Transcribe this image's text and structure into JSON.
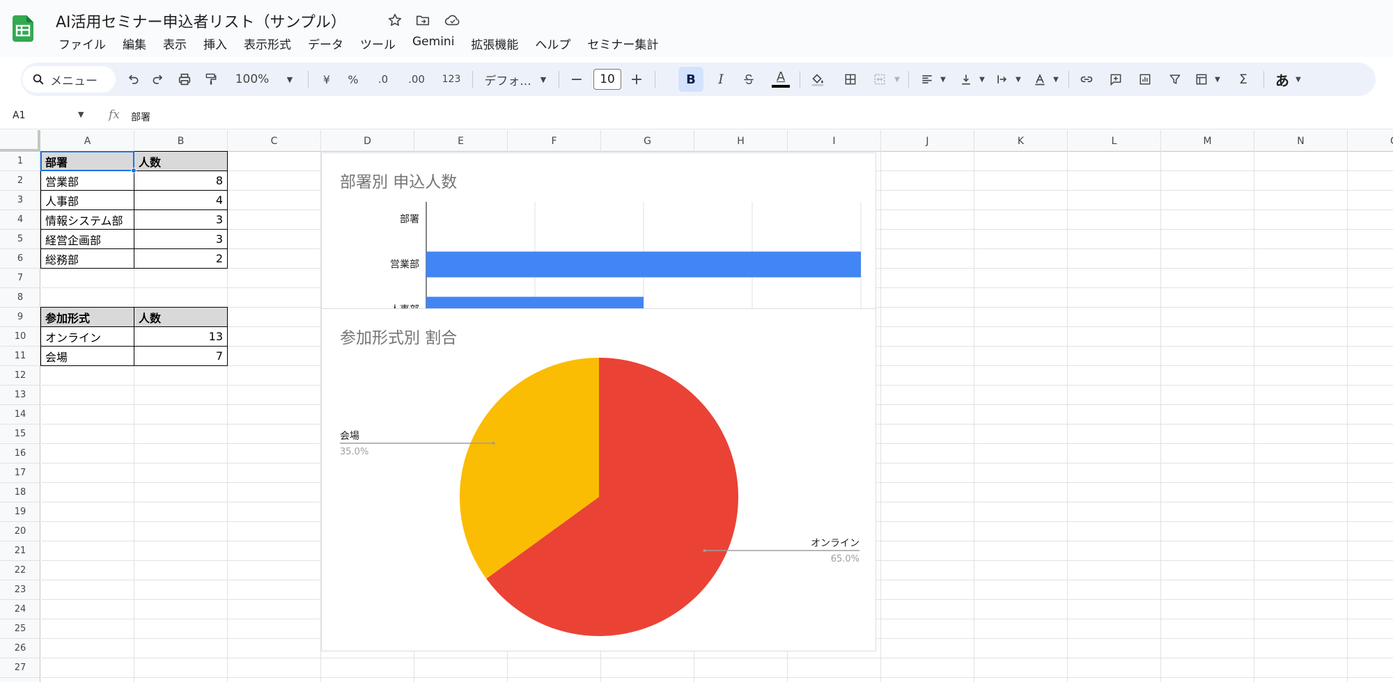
{
  "app": {
    "doc_title": "AI活用セミナー申込者リスト（サンプル）",
    "menu": [
      "ファイル",
      "編集",
      "表示",
      "挿入",
      "表示形式",
      "データ",
      "ツール",
      "Gemini",
      "拡張機能",
      "ヘルプ",
      "セミナー集計"
    ]
  },
  "toolbar": {
    "search_label": "メニュー",
    "zoom": "100%",
    "currency": "¥",
    "percent": "%",
    "decrease_decimal": ".0",
    "increase_decimal": ".00",
    "number_format": "123",
    "font_name": "デフォ...",
    "minus": "−",
    "font_size": "10",
    "plus": "+",
    "bold": "B",
    "italic": "I",
    "text_color": "A",
    "function": "Σ",
    "input_mode": "あ"
  },
  "formula_bar": {
    "cell_ref": "A1",
    "fx": "fx",
    "value": "部署"
  },
  "sheet": {
    "columns": [
      "A",
      "B",
      "C",
      "D",
      "E",
      "F",
      "G",
      "H",
      "I",
      "J",
      "K",
      "L",
      "M",
      "N",
      "O"
    ],
    "rows": [
      "1",
      "2",
      "3",
      "4",
      "5",
      "6",
      "7",
      "8",
      "9",
      "10",
      "11",
      "12",
      "13",
      "14",
      "15",
      "16",
      "17",
      "18",
      "19",
      "20",
      "21",
      "22",
      "23",
      "24",
      "25",
      "26",
      "27"
    ],
    "table1": {
      "header": [
        "部署",
        "人数"
      ],
      "rows": [
        {
          "label": "営業部",
          "value": "8"
        },
        {
          "label": "人事部",
          "value": "4"
        },
        {
          "label": "情報システム部",
          "value": "3"
        },
        {
          "label": "経営企画部",
          "value": "3"
        },
        {
          "label": "総務部",
          "value": "2"
        }
      ]
    },
    "table2": {
      "header": [
        "参加形式",
        "人数"
      ],
      "rows": [
        {
          "label": "オンライン",
          "value": "13"
        },
        {
          "label": "会場",
          "value": "7"
        }
      ]
    }
  },
  "colors": {
    "bar": "#4285f4",
    "online": "#ea4335",
    "venue": "#fbbc04",
    "selection": "#1a73e8"
  },
  "chart_data": [
    {
      "type": "bar",
      "orientation": "horizontal",
      "title": "部署別 申込人数",
      "categories": [
        "部署",
        "営業部",
        "人事部"
      ],
      "values": [
        0,
        8,
        4
      ],
      "xlim": [
        0,
        8
      ],
      "grid": true,
      "note": "chart partially covered by pie chart; only first categories visible"
    },
    {
      "type": "pie",
      "title": "参加形式別 割合",
      "slices": [
        {
          "label": "オンライン",
          "value": 13,
          "percent_label": "65.0%",
          "color": "#ea4335"
        },
        {
          "label": "会場",
          "value": 7,
          "percent_label": "35.0%",
          "color": "#fbbc04"
        }
      ]
    }
  ]
}
